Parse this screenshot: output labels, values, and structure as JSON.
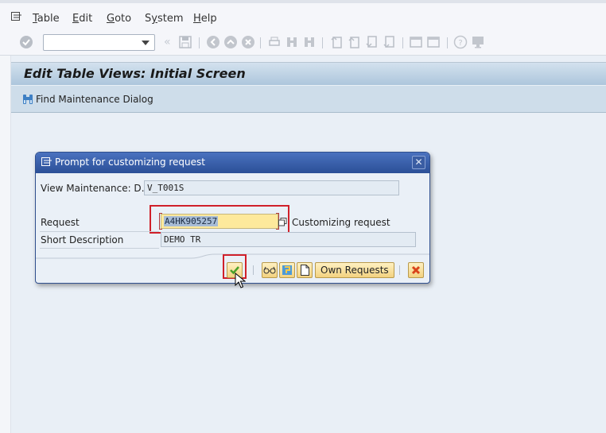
{
  "menubar": {
    "items": [
      {
        "label": "Table",
        "mnemonic": "T"
      },
      {
        "label": "Edit",
        "mnemonic": "E"
      },
      {
        "label": "Goto",
        "mnemonic": "G"
      },
      {
        "label": "System",
        "mnemonic": "y"
      },
      {
        "label": "Help",
        "mnemonic": "H"
      }
    ]
  },
  "toolbar": {
    "command_field_value": "",
    "icons": [
      "enter-icon",
      "back-icon",
      "save-icon",
      "back-nav-icon",
      "exit-icon",
      "cancel-icon",
      "print-icon",
      "find-icon",
      "find-next-icon",
      "first-page-icon",
      "previous-page-icon",
      "next-page-icon",
      "last-page-icon",
      "create-session-icon",
      "shortcut-icon",
      "help-icon",
      "customize-layout-icon"
    ]
  },
  "screen": {
    "title": "Edit Table Views: Initial Screen",
    "app_toolbar": {
      "find_button_label": "Find Maintenance Dialog"
    }
  },
  "dialog": {
    "title": "Prompt for customizing request",
    "fields": {
      "view_label": "View Maintenance: D…",
      "view_value": "V_T001S",
      "request_label": "Request",
      "request_value": "A4HK905257",
      "request_type_label": "Customizing request",
      "short_desc_label": "Short Description",
      "short_desc_value": "DEMO TR"
    },
    "footer": {
      "own_requests_label": "Own Requests"
    }
  },
  "colors": {
    "dialog_header": "#2b4f97",
    "highlight": "#d0202a",
    "request_field_bg": "#fde99c",
    "button_bg": "#f3d280"
  }
}
